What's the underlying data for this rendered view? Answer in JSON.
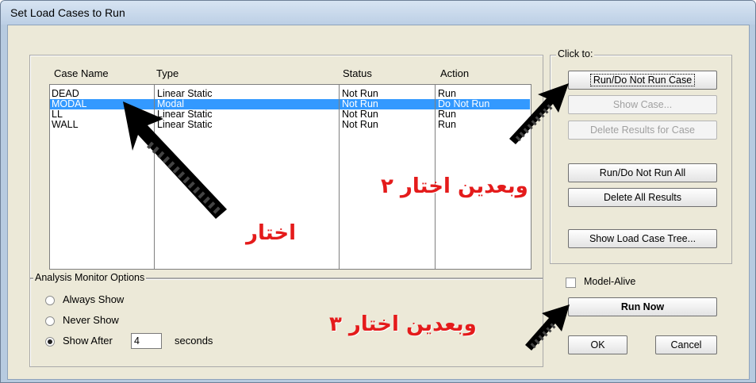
{
  "window": {
    "title": "Set Load Cases to Run"
  },
  "cases_table": {
    "headers": [
      "Case Name",
      "Type",
      "Status",
      "Action"
    ],
    "rows": [
      {
        "name": "DEAD",
        "type": "Linear Static",
        "status": "Not Run",
        "action": "Run",
        "selected": false
      },
      {
        "name": "MODAL",
        "type": "Modal",
        "status": "Not Run",
        "action": "Do Not Run",
        "selected": true
      },
      {
        "name": "LL",
        "type": "Linear Static",
        "status": "Not Run",
        "action": "Run",
        "selected": false
      },
      {
        "name": "WALL",
        "type": "Linear Static",
        "status": "Not Run",
        "action": "Run",
        "selected": false
      }
    ]
  },
  "click_to": {
    "label": "Click to:",
    "run_do_not_run_case": "Run/Do Not Run Case",
    "show_case": "Show Case...",
    "delete_results_for_case": "Delete Results for Case",
    "run_do_not_run_all": "Run/Do Not Run All",
    "delete_all_results": "Delete All Results",
    "show_load_case_tree": "Show Load Case Tree..."
  },
  "analysis_monitor": {
    "label": "Analysis Monitor Options",
    "options": [
      "Always Show",
      "Never Show",
      "Show After"
    ],
    "selected": "Show After",
    "seconds_value": "4",
    "seconds_label": "seconds"
  },
  "model_alive": {
    "label": "Model-Alive",
    "checked": false
  },
  "actions": {
    "run_now": "Run Now",
    "ok": "OK",
    "cancel": "Cancel"
  },
  "annotations": {
    "step1": "اختار",
    "step2": "وبعدين اختار ٢",
    "step3": "وبعدين اختار ٣",
    "color": "#e41b1b"
  },
  "colors": {
    "selection": "#3399ff",
    "dialog": "#ece9d8",
    "titlebar": "#bccfe5"
  }
}
